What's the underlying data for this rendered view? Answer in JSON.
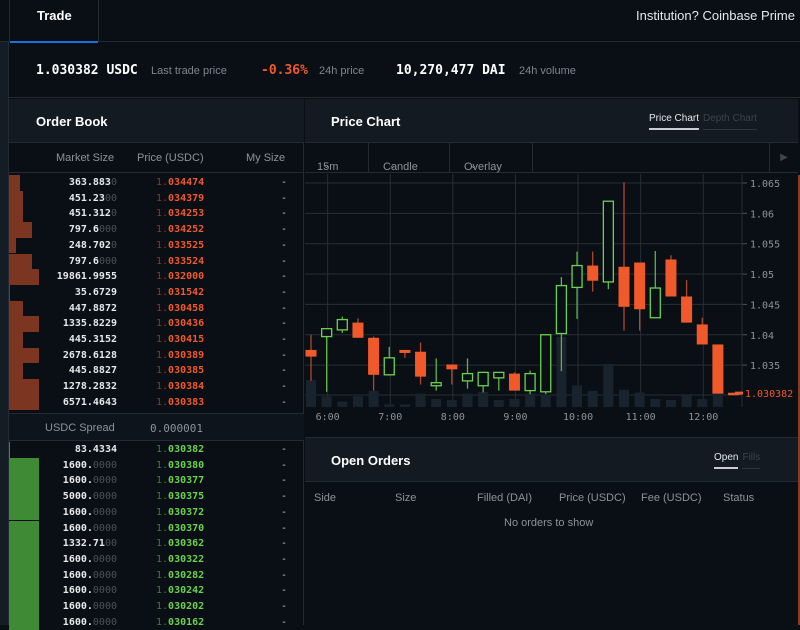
{
  "topbar": {
    "tab_label": "Trade",
    "prime_link": "Institution? Coinbase Prime"
  },
  "stats": {
    "last_price": "1.030382 USDC",
    "last_price_label": "Last trade price",
    "change": "-0.36%",
    "change_label": "24h price",
    "volume": "10,270,477 DAI",
    "volume_label": "24h volume"
  },
  "order_book": {
    "title": "Order Book",
    "columns": [
      "Market Size",
      "Price (USDC)",
      "My Size"
    ],
    "asks": [
      {
        "size": "363.883",
        "size_dim": "0",
        "price": "1.034474",
        "my": "-",
        "depth": 0.3
      },
      {
        "size": "451.23",
        "size_dim": "00",
        "price": "1.034379",
        "my": "-",
        "depth": 0.37
      },
      {
        "size": "451.312",
        "size_dim": "0",
        "price": "1.034253",
        "my": "-",
        "depth": 0.37
      },
      {
        "size": "797.6",
        "size_dim": "000",
        "price": "1.034252",
        "my": "-",
        "depth": 0.63
      },
      {
        "size": "248.702",
        "size_dim": "0",
        "price": "1.033525",
        "my": "-",
        "depth": 0.2
      },
      {
        "size": "797.6",
        "size_dim": "000",
        "price": "1.033524",
        "my": "-",
        "depth": 0.63
      },
      {
        "size": "19861.9955",
        "size_dim": "",
        "price": "1.032000",
        "my": "-",
        "depth": 0.8
      },
      {
        "size": "35.6729",
        "size_dim": "",
        "price": "1.031542",
        "my": "-",
        "depth": 0.03
      },
      {
        "size": "447.8872",
        "size_dim": "",
        "price": "1.030458",
        "my": "-",
        "depth": 0.37
      },
      {
        "size": "1335.8229",
        "size_dim": "",
        "price": "1.030436",
        "my": "-",
        "depth": 0.8
      },
      {
        "size": "445.3152",
        "size_dim": "",
        "price": "1.030415",
        "my": "-",
        "depth": 0.37
      },
      {
        "size": "2678.6128",
        "size_dim": "",
        "price": "1.030389",
        "my": "-",
        "depth": 0.8
      },
      {
        "size": "445.8827",
        "size_dim": "",
        "price": "1.030385",
        "my": "-",
        "depth": 0.37
      },
      {
        "size": "1278.2832",
        "size_dim": "",
        "price": "1.030384",
        "my": "-",
        "depth": 0.8
      },
      {
        "size": "6571.4643",
        "size_dim": "",
        "price": "1.030383",
        "my": "-",
        "depth": 0.8
      }
    ],
    "spread_label": "USDC Spread",
    "spread_value": "0.000001",
    "bids": [
      {
        "size": "83.4334",
        "size_dim": "",
        "price": "1.030382",
        "my": "-",
        "depth": 0.02
      },
      {
        "size": "1600.",
        "size_dim": "0000",
        "price": "1.030380",
        "my": "-",
        "depth": 0.8
      },
      {
        "size": "1600.",
        "size_dim": "0000",
        "price": "1.030377",
        "my": "-",
        "depth": 0.8
      },
      {
        "size": "5000.",
        "size_dim": "0000",
        "price": "1.030375",
        "my": "-",
        "depth": 0.8
      },
      {
        "size": "1600.",
        "size_dim": "0000",
        "price": "1.030372",
        "my": "-",
        "depth": 0.8
      },
      {
        "size": "1600.",
        "size_dim": "0000",
        "price": "1.030370",
        "my": "-",
        "depth": 0.8
      },
      {
        "size": "1332.71",
        "size_dim": "00",
        "price": "1.030362",
        "my": "-",
        "depth": 0.8
      },
      {
        "size": "1600.",
        "size_dim": "0000",
        "price": "1.030322",
        "my": "-",
        "depth": 0.8
      },
      {
        "size": "1600.",
        "size_dim": "0000",
        "price": "1.030282",
        "my": "-",
        "depth": 0.8
      },
      {
        "size": "1600.",
        "size_dim": "0000",
        "price": "1.030242",
        "my": "-",
        "depth": 0.8
      },
      {
        "size": "1600.",
        "size_dim": "0000",
        "price": "1.030202",
        "my": "-",
        "depth": 0.8
      },
      {
        "size": "1600.",
        "size_dim": "0000",
        "price": "1.030162",
        "my": "-",
        "depth": 0.8
      }
    ]
  },
  "price_chart": {
    "title": "Price Chart",
    "tabs": [
      "Price Chart",
      "Depth Chart"
    ],
    "active_tab": "Price Chart",
    "interval": "15m",
    "chart_type": "Candle",
    "overlay": "Overlay",
    "play_icon": "play-icon"
  },
  "open_orders": {
    "title": "Open Orders",
    "tabs": [
      "Open",
      "Fills"
    ],
    "active_tab": "Open",
    "columns": [
      "Side",
      "Size",
      "Filled (DAI)",
      "Price (USDC)",
      "Fee (USDC)",
      "Status"
    ],
    "empty_text": "No orders to show"
  },
  "colors": {
    "ask": "#f05a2a",
    "bid": "#6bd14f",
    "ask_depth": "#7c3520",
    "bid_depth": "#3f8a35",
    "accent": "#1e6fd9"
  },
  "chart_data": {
    "type": "candlestick",
    "title": "Price Chart",
    "interval": "15m",
    "xlabel": "",
    "ylabel": "",
    "x_ticks": [
      "6:00",
      "7:00",
      "8:00",
      "9:00",
      "10:00",
      "11:00",
      "12:00"
    ],
    "y_ticks": [
      1.035,
      1.04,
      1.045,
      1.05,
      1.055,
      1.06,
      1.065
    ],
    "ylim": [
      1.0285,
      1.0665
    ],
    "last_price": 1.030382,
    "last_price_label": "1.030382",
    "start_time": "5:45",
    "candles": [
      {
        "o": 1.0375,
        "c": 1.0364,
        "h": 1.04,
        "l": 1.0324,
        "v": 5
      },
      {
        "o": 1.0397,
        "c": 1.041,
        "h": 1.041,
        "l": 1.0306,
        "v": 2
      },
      {
        "o": 1.0408,
        "c": 1.0425,
        "h": 1.043,
        "l": 1.0403,
        "v": 1
      },
      {
        "o": 1.042,
        "c": 1.0395,
        "h": 1.0427,
        "l": 1.0395,
        "v": 2
      },
      {
        "o": 1.0395,
        "c": 1.0334,
        "h": 1.0397,
        "l": 1.0308,
        "v": 3
      },
      {
        "o": 1.0334,
        "c": 1.0362,
        "h": 1.038,
        "l": 1.0333,
        "v": 0.5
      },
      {
        "o": 1.0375,
        "c": 1.037,
        "h": 1.0375,
        "l": 1.0362,
        "v": 0.5
      },
      {
        "o": 1.0372,
        "c": 1.0331,
        "h": 1.0387,
        "l": 1.0318,
        "v": 2.5
      },
      {
        "o": 1.0316,
        "c": 1.0321,
        "h": 1.0361,
        "l": 1.0308,
        "v": 1.5
      },
      {
        "o": 1.0351,
        "c": 1.0343,
        "h": 1.0351,
        "l": 1.0318,
        "v": 1.3
      },
      {
        "o": 1.0324,
        "c": 1.0336,
        "h": 1.0361,
        "l": 1.0311,
        "v": 2.5
      },
      {
        "o": 1.0316,
        "c": 1.0338,
        "h": 1.0338,
        "l": 1.0305,
        "v": 2.8
      },
      {
        "o": 1.0329,
        "c": 1.0338,
        "h": 1.0338,
        "l": 1.0308,
        "v": 1.3
      },
      {
        "o": 1.0336,
        "c": 1.0308,
        "h": 1.0338,
        "l": 1.0308,
        "v": 1.5
      },
      {
        "o": 1.0308,
        "c": 1.0336,
        "h": 1.0341,
        "l": 1.0302,
        "v": 2.5
      },
      {
        "o": 1.0306,
        "c": 1.04,
        "h": 1.04,
        "l": 1.0302,
        "v": 2.3
      },
      {
        "o": 1.0402,
        "c": 1.0481,
        "h": 1.0495,
        "l": 1.034,
        "v": 13
      },
      {
        "o": 1.0478,
        "c": 1.0514,
        "h": 1.0537,
        "l": 1.0426,
        "v": 4
      },
      {
        "o": 1.0514,
        "c": 1.0489,
        "h": 1.0537,
        "l": 1.0471,
        "v": 3
      },
      {
        "o": 1.0487,
        "c": 1.062,
        "h": 1.062,
        "l": 1.0475,
        "v": 8
      },
      {
        "o": 1.0512,
        "c": 1.0446,
        "h": 1.0651,
        "l": 1.0407,
        "v": 3.2
      },
      {
        "o": 1.0519,
        "c": 1.0442,
        "h": 1.0519,
        "l": 1.0407,
        "v": 2.7
      },
      {
        "o": 1.0428,
        "c": 1.0477,
        "h": 1.0538,
        "l": 1.0428,
        "v": 1.5
      },
      {
        "o": 1.0524,
        "c": 1.0463,
        "h": 1.0531,
        "l": 1.0463,
        "v": 1.3
      },
      {
        "o": 1.0463,
        "c": 1.042,
        "h": 1.049,
        "l": 1.042,
        "v": 2.2
      },
      {
        "o": 1.0417,
        "c": 1.0384,
        "h": 1.0428,
        "l": 1.0384,
        "v": 1.5
      },
      {
        "o": 1.0384,
        "c": 1.0303,
        "h": 1.0384,
        "l": 1.0303,
        "v": 2.5
      },
      {
        "o": 1.03045,
        "c": 1.03038,
        "h": 1.03045,
        "l": 1.03038,
        "v": 0
      }
    ]
  }
}
